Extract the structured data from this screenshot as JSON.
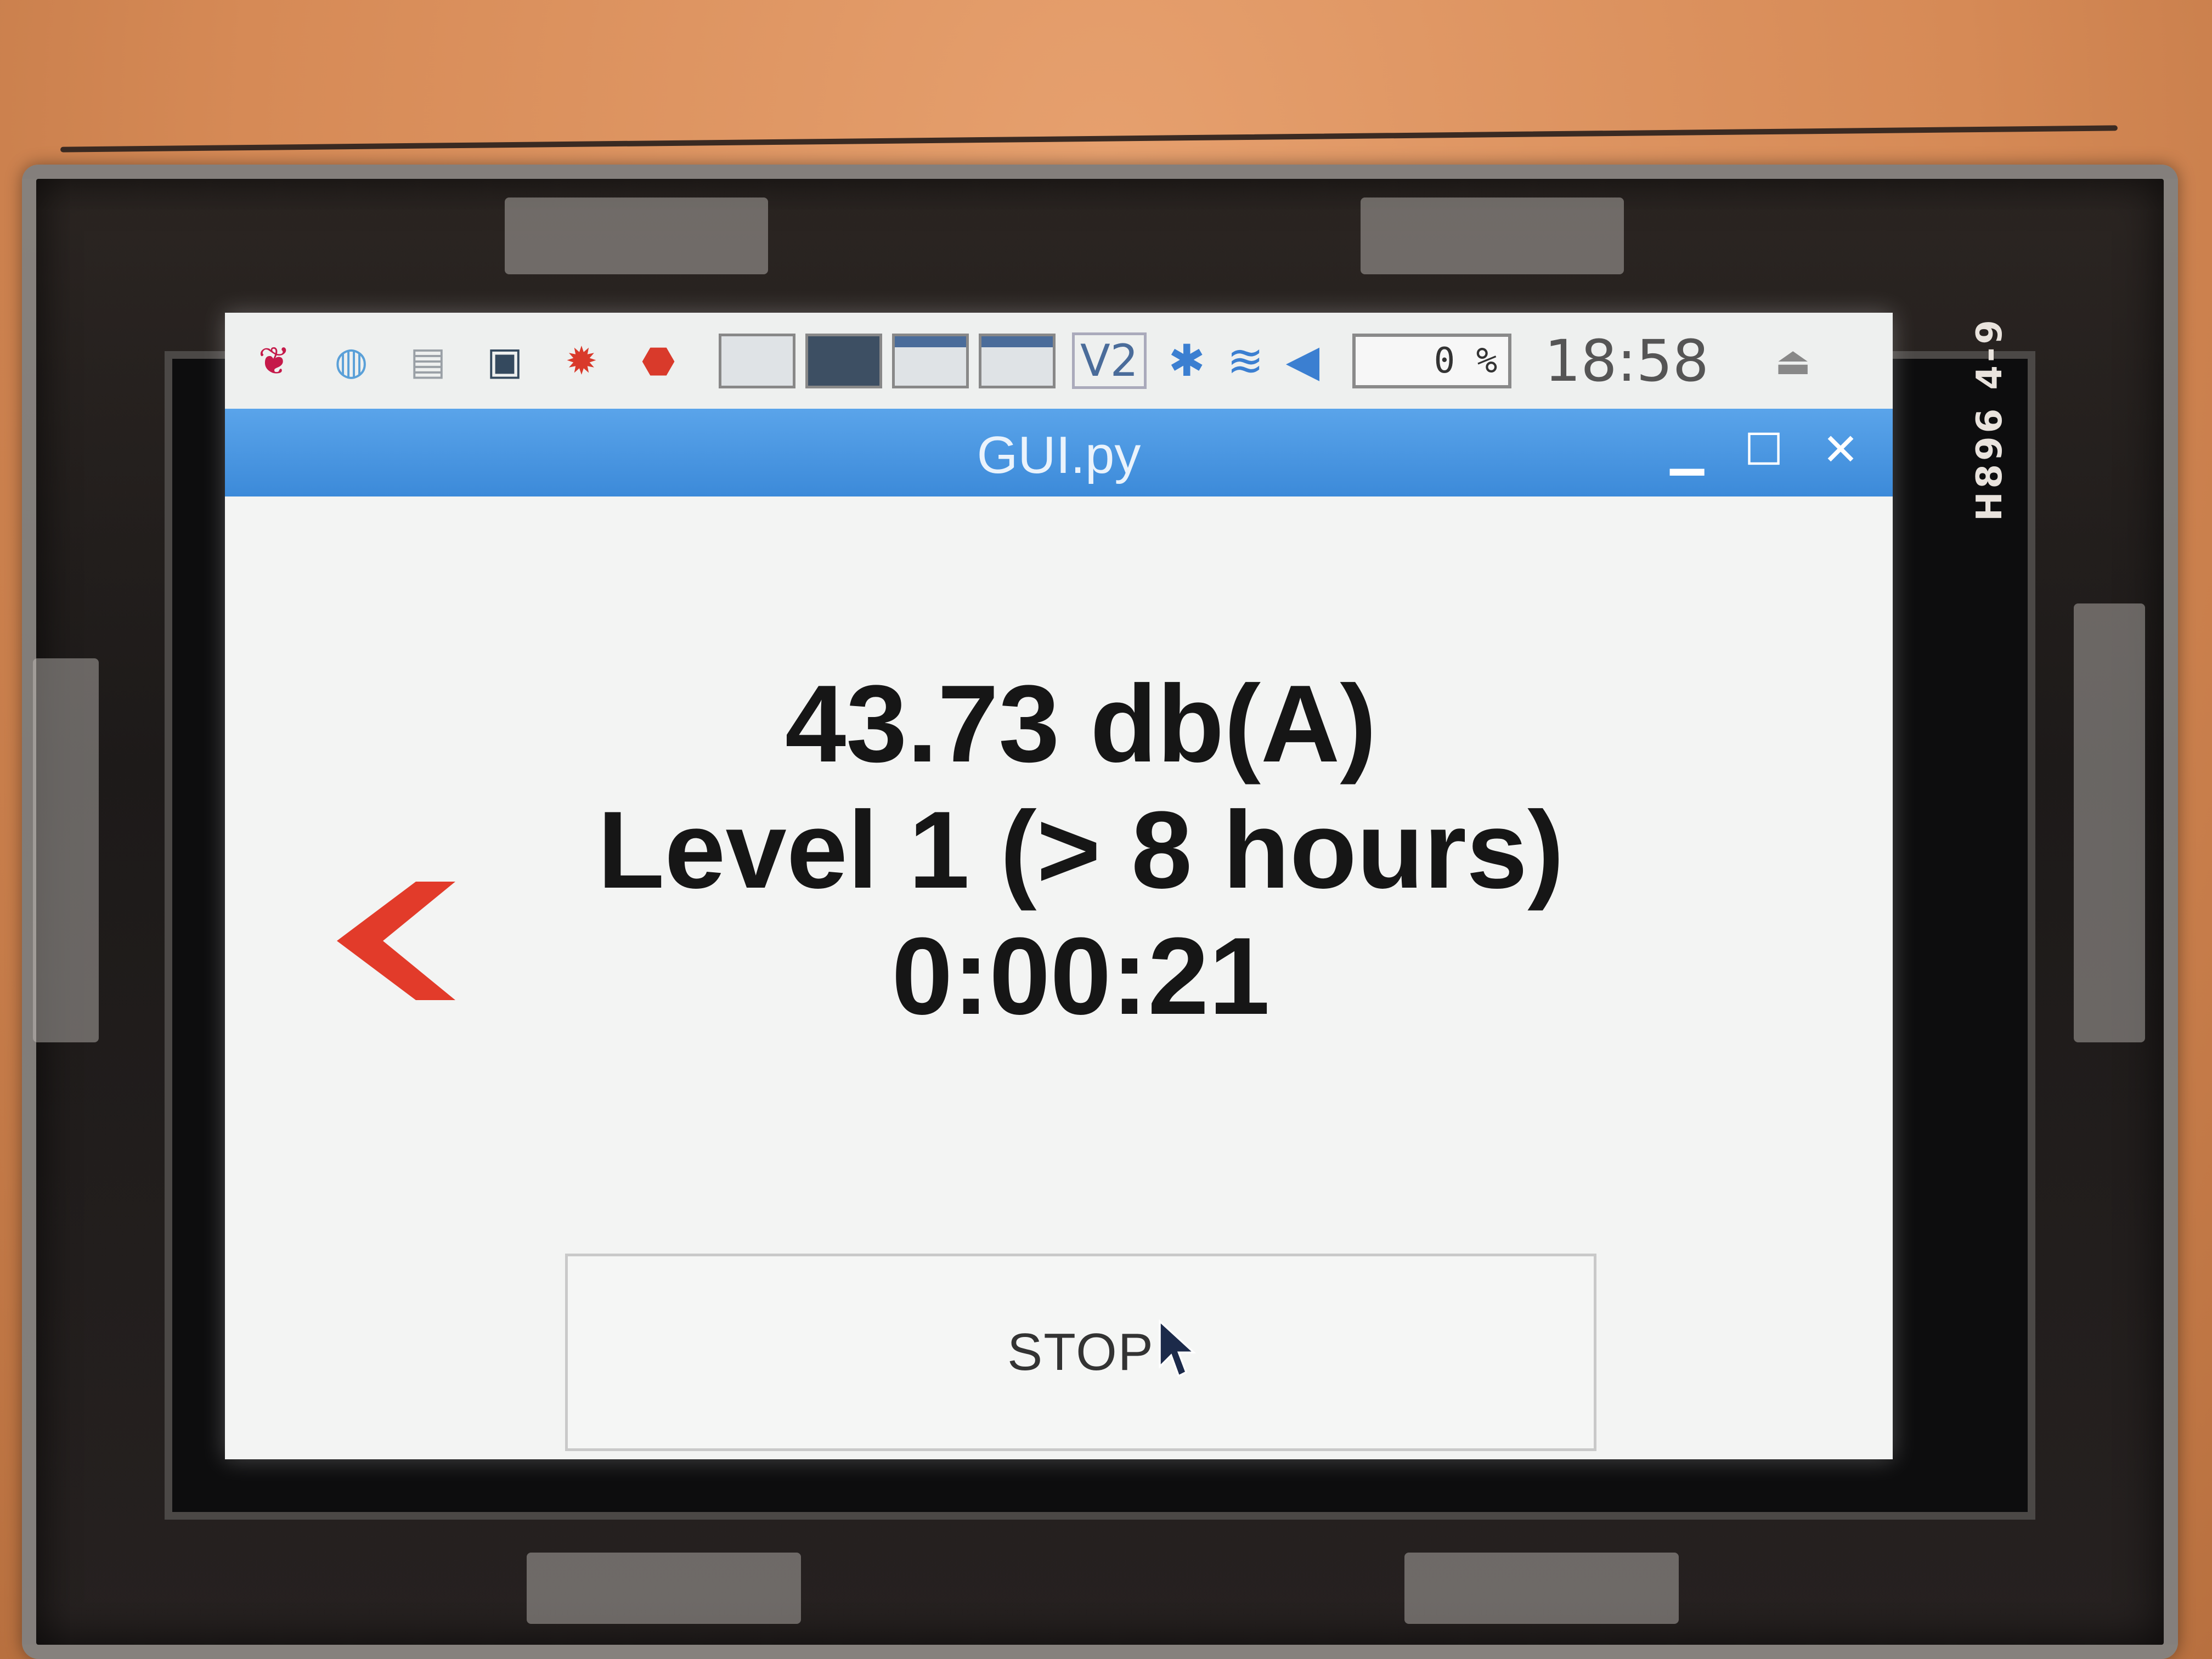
{
  "taskbar": {
    "launchers": [
      {
        "icon": "raspberry-menu-icon",
        "glyph": "❦",
        "color": "#c51a4a"
      },
      {
        "icon": "web-browser-icon",
        "glyph": "◍",
        "color": "#5aa0d8"
      },
      {
        "icon": "file-manager-icon",
        "glyph": "▤",
        "color": "#9aa0a6"
      },
      {
        "icon": "terminal-icon",
        "glyph": "▣",
        "color": "#34495e"
      },
      {
        "icon": "math-app-icon",
        "glyph": "✹",
        "color": "#d93a2b"
      },
      {
        "icon": "wolfram-icon",
        "glyph": "⬣",
        "color": "#d93a2b"
      }
    ],
    "vnc_label": "V2",
    "cpu_usage": "0 %",
    "clock": "18:58"
  },
  "window": {
    "title": "GUI.py",
    "minimize_glyph": "▁",
    "maximize_glyph": "☐",
    "close_glyph": "✕"
  },
  "readout": {
    "level_db": "43.73 db(A)",
    "exposure_level": "Level 1 (> 8 hours)",
    "elapsed": "0:00:21"
  },
  "controls": {
    "stop_label": "STOP"
  },
  "colors": {
    "title_bar": "#3c8ad9",
    "back_arrow": "#e23b2a"
  },
  "hardware": {
    "pcb_label": "H896  4-9"
  }
}
